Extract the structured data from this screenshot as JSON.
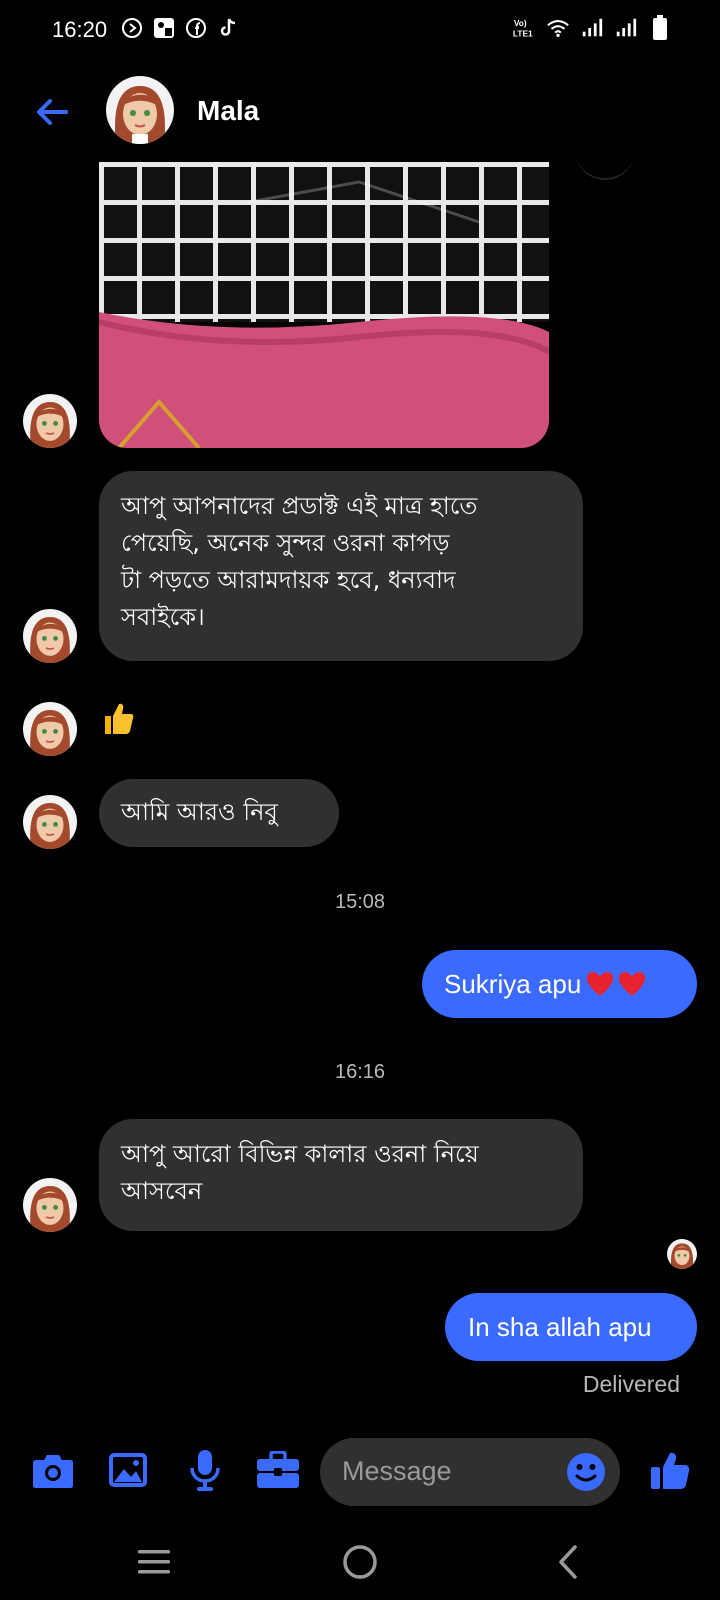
{
  "status_bar": {
    "time": "16:20",
    "left_icons": [
      "media-play-icon",
      "facebook-page-icon",
      "facebook-icon",
      "tiktok-icon"
    ],
    "right_icons": [
      "volte-icon",
      "wifi-icon",
      "signal-icon",
      "signal-icon",
      "battery-icon"
    ],
    "volte_label": "Vo₀ LTE1"
  },
  "header": {
    "contact_name": "Mala"
  },
  "messages": [
    {
      "direction": "in",
      "type": "image",
      "description_icon": "photo-attachment"
    },
    {
      "direction": "in",
      "text": "আপু আপনাদের প্রডাক্ট এই মাত্র হাতে পেয়েছি, অনেক সুন্দর ওরনা কাপড় টা পড়তে আরামদায়ক হবে, ধন্যবাদ সবাইকে।",
      "lines": [
        "আপু আপনাদের প্রডাক্ট এই মাত্র হাতে",
        "পেয়েছি, অনেক সুন্দর ওরনা কাপড়",
        "টা পড়তে আরামদায়ক হবে, ধন্যবাদ",
        "সবাইকে।"
      ]
    },
    {
      "direction": "in",
      "type": "emoji",
      "text": "👍"
    },
    {
      "direction": "in",
      "text": "আমি আরও নিবু"
    },
    {
      "type": "timestamp",
      "text": "15:08"
    },
    {
      "direction": "out",
      "text": "Sukriya apu",
      "suffix": "❤️❤️"
    },
    {
      "type": "timestamp",
      "text": "16:16"
    },
    {
      "direction": "in",
      "text": "আপু আরো বিভিন্ন কালার ওরনা নিয়ে আসবেন",
      "lines": [
        "আপু আরো বিভিন্ন কালার ওরনা নিয়ে",
        "আসবেন"
      ]
    },
    {
      "direction": "out",
      "text": "In sha allah apu"
    }
  ],
  "status": {
    "delivered": "Delivered"
  },
  "composer": {
    "placeholder": "Message",
    "icons": [
      "camera-icon",
      "gallery-icon",
      "microphone-icon",
      "briefcase-icon",
      "emoji-icon",
      "thumbs-up-icon"
    ]
  },
  "colors": {
    "accent": "#3a6aff",
    "incoming_bubble": "#303030",
    "background": "#000000",
    "muted_text": "#b8b8b8"
  }
}
